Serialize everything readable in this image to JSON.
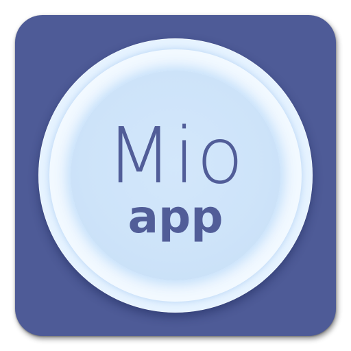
{
  "app_icon": {
    "title": "Mio",
    "subtitle": "app",
    "colors": {
      "tile": "#4e5b97",
      "disc": "#cde3f9",
      "text": "#515d98"
    }
  }
}
